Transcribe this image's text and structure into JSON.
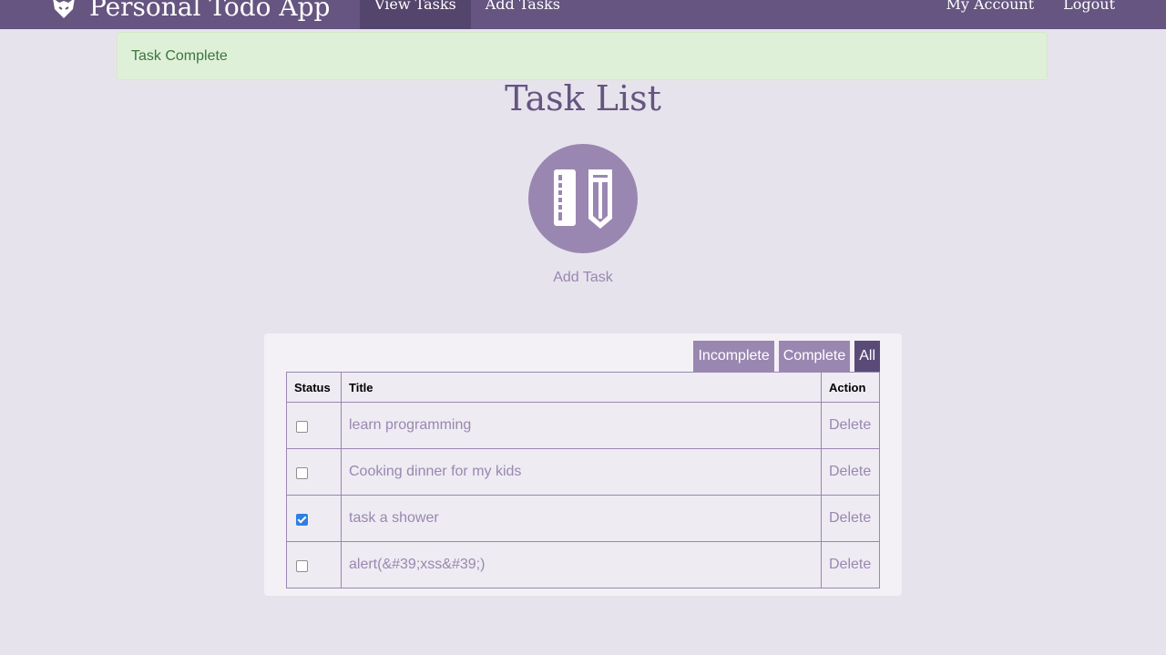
{
  "navbar": {
    "brand": "Personal Todo App",
    "left_items": [
      {
        "label": "View Tasks",
        "active": true
      },
      {
        "label": "Add Tasks",
        "active": false
      }
    ],
    "right_items": [
      {
        "label": "My Account"
      },
      {
        "label": "Logout"
      }
    ]
  },
  "alert": {
    "text": "Task Complete"
  },
  "page": {
    "title": "Task List",
    "add_task_label": "Add Task",
    "add_task_icon": "ruler-pencil-icon"
  },
  "filters": [
    {
      "label": "Incomplete",
      "active": false
    },
    {
      "label": "Complete",
      "active": false
    },
    {
      "label": "All",
      "active": true
    }
  ],
  "table": {
    "headers": {
      "status": "Status",
      "title": "Title",
      "action": "Action"
    },
    "rows": [
      {
        "checked": false,
        "title": "learn programming",
        "action": "Delete"
      },
      {
        "checked": false,
        "title": "Cooking dinner for my kids",
        "action": "Delete"
      },
      {
        "checked": true,
        "title": "task a shower",
        "action": "Delete"
      },
      {
        "checked": false,
        "title": "alert(&#39;xss&#39;)",
        "action": "Delete"
      }
    ]
  },
  "colors": {
    "navbar": "#655580",
    "accent": "#9a87b1",
    "active_filter": "#5a4a78",
    "alert_bg": "#dff0d8",
    "alert_text": "#3c763d",
    "checkbox_checked": "#2f7fe0"
  }
}
